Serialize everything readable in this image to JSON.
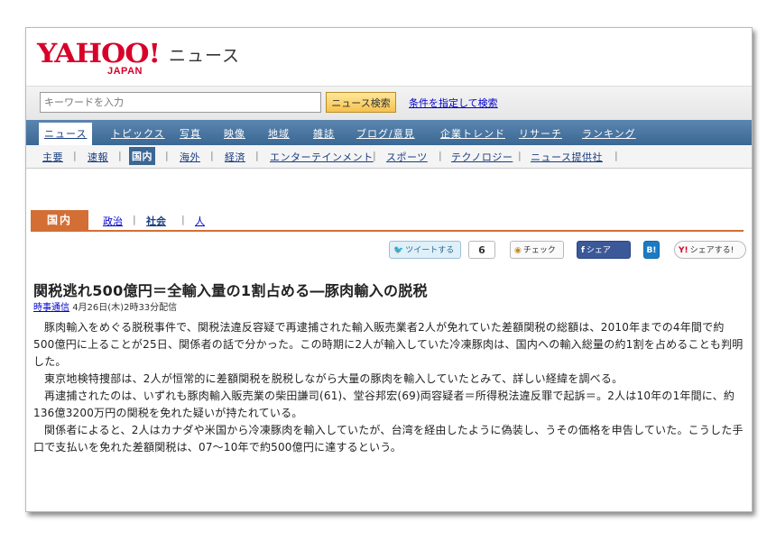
{
  "header": {
    "logo_text": "YAHOO!",
    "logo_sub": "JAPAN",
    "service_name": "ニュース"
  },
  "search": {
    "placeholder": "キーワードを入力",
    "button_label": "ニュース検索",
    "advanced_link": "条件を指定して検索"
  },
  "nav": {
    "tabs": [
      "ニュース",
      "トピックス",
      "写真",
      "映像",
      "地域",
      "雑誌",
      "ブログ/意見",
      "企業トレンド",
      "リサーチ",
      "ランキング"
    ]
  },
  "subnav": {
    "items": [
      "主要",
      "速報",
      "国内",
      "海外",
      "経済",
      "エンターテインメント",
      "スポーツ",
      "テクノロジー",
      "ニュース提供社"
    ]
  },
  "category": {
    "label": "国内",
    "subs": [
      "政治",
      "社会",
      "人"
    ]
  },
  "social": {
    "tweet_label": "ツイートする",
    "tweet_count": "6",
    "check_label": "チェック",
    "share_label": "シェア",
    "hatena_label": "B!",
    "yahoo_share_label": "シェアする!"
  },
  "article": {
    "title": "関税逃れ500億円＝全輸入量の1割占める―豚肉輸入の脱税",
    "source": "時事通信",
    "date": "4月26日(木)2時33分配信",
    "paragraphs": [
      "豚肉輸入をめぐる脱税事件で、関税法違反容疑で再逮捕された輸入販売業者2人が免れていた差額関税の総額は、2010年までの4年間で約500億円に上ることが25日、関係者の話で分かった。この時期に2人が輸入していた冷凍豚肉は、国内への輸入総量の約1割を占めることも判明した。",
      "東京地検特捜部は、2人が恒常的に差額関税を脱税しながら大量の豚肉を輸入していたとみて、詳しい経緯を調べる。",
      "再逮捕されたのは、いずれも豚肉輸入販売業の柴田謙司(61)、堂谷邦宏(69)両容疑者＝所得税法違反罪で起訴＝。2人は10年の1年間に、約136億3200万円の関税を免れた疑いが持たれている。",
      "関係者によると、2人はカナダや米国から冷凍豚肉を輸入していたが、台湾を経由したように偽装し、うその価格を申告していた。こうした手口で支払いを免れた差額関税は、07～10年で約500億円に達するという。"
    ]
  },
  "colors": {
    "brand_red": "#d8002a",
    "nav_blue": "#3a6794",
    "category_orange": "#d36e35",
    "link_blue": "#0000cc"
  }
}
